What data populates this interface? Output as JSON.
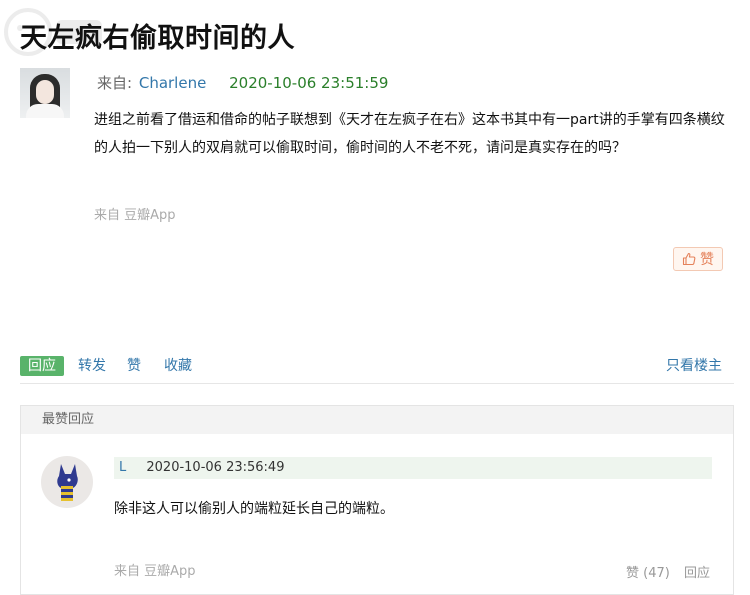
{
  "post": {
    "title": "天左疯右偷取时间的人",
    "from_label": "来自:",
    "author": "Charlene",
    "timestamp": "2020-10-06 23:51:59",
    "body": "进组之前看了借运和借命的帖子联想到《天才在左疯子在右》这本书其中有一part讲的手掌有四条横纹的人拍一下别人的双肩就可以偷取时间，偷时间的人不老不死，请问是真实存在的吗？",
    "source": "来自 豆瓣App",
    "like_label": "赞"
  },
  "actions": {
    "reply": "回应",
    "repost": "转发",
    "like": "赞",
    "collect": "收藏",
    "only_op": "只看楼主"
  },
  "best_replies": {
    "header": "最赞回应",
    "items": [
      {
        "user": "L",
        "timestamp": "2020-10-06 23:56:49",
        "text": "除非这人可以偷别人的端粒延长自己的端粒。",
        "source": "来自 豆瓣App",
        "like": "赞 (47)",
        "reply": "回应"
      }
    ]
  },
  "colors": {
    "link": "#3377aa",
    "reply_button": "#59b36a",
    "timestamp_green": "#2a7f2a",
    "like_orange": "#e4815a"
  }
}
